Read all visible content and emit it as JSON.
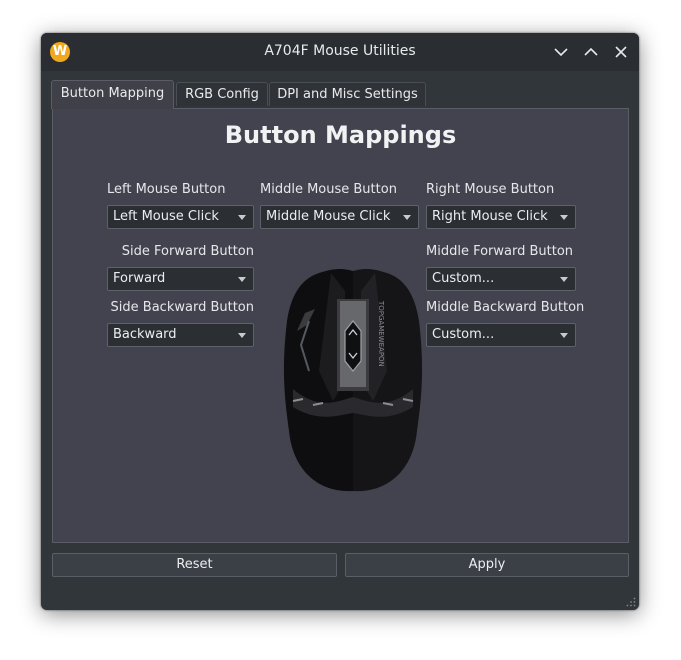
{
  "window": {
    "title": "A704F Mouse Utilities",
    "app_icon_letter": "W"
  },
  "tabs": [
    {
      "label": "Button Mapping",
      "active": true
    },
    {
      "label": "RGB Config",
      "active": false
    },
    {
      "label": "DPI and Misc Settings",
      "active": false
    }
  ],
  "panel": {
    "title": "Button Mappings",
    "left_mouse": {
      "label": "Left Mouse Button",
      "value": "Left Mouse Click"
    },
    "middle_mouse": {
      "label": "Middle Mouse Button",
      "value": "Middle Mouse Click"
    },
    "right_mouse": {
      "label": "Right Mouse Button",
      "value": "Right Mouse Click"
    },
    "side_forward": {
      "label": "Side Forward Button",
      "value": "Forward"
    },
    "side_backward": {
      "label": "Side Backward Button",
      "value": "Backward"
    },
    "middle_forward": {
      "label": "Middle Forward Button",
      "value": "Custom..."
    },
    "middle_backward": {
      "label": "Middle Backward Button",
      "value": "Custom..."
    },
    "mouse_brand_text": "TOPGAMEWEAPON"
  },
  "buttons": {
    "reset": "Reset",
    "apply": "Apply"
  },
  "colors": {
    "accent_icon": "#f0a81e",
    "panel_bg": "#43434f",
    "window_bg": "#31363b"
  }
}
